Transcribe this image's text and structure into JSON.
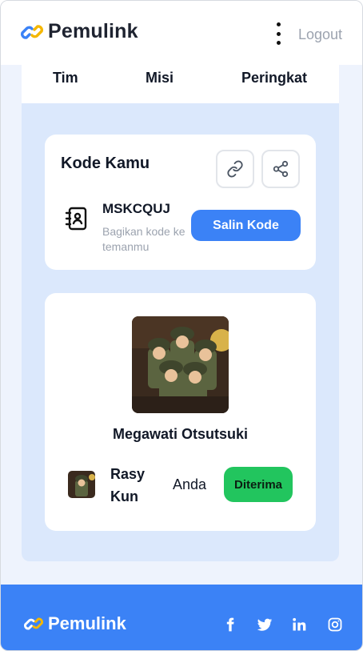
{
  "header": {
    "brand": "Pemulink",
    "logout_label": "Logout",
    "logo_colors": {
      "blue": "#3b82f6",
      "yellow": "#f5b700"
    }
  },
  "tabs": [
    {
      "label": "Tim"
    },
    {
      "label": "Misi"
    },
    {
      "label": "Peringkat"
    }
  ],
  "code_card": {
    "title": "Kode Kamu",
    "code": "MSKCQUJ",
    "hint": "Bagikan kode ke temanmu",
    "copy_label": "Salin Kode",
    "icons": [
      "link-icon",
      "share-icon",
      "contact-book-icon"
    ]
  },
  "member_card": {
    "name": "Megawati Otsutsuki",
    "row": {
      "name": "Rasy Kun",
      "role": "Anda",
      "status": "Diterima",
      "status_color": "#22c55e"
    }
  },
  "footer": {
    "brand": "Pemulink",
    "background": "#3b82f6",
    "social_icons": [
      "facebook-icon",
      "twitter-icon",
      "linkedin-icon",
      "instagram-icon"
    ]
  },
  "colors": {
    "accent": "#3b82f6",
    "page_bg": "#dbe8fc"
  }
}
